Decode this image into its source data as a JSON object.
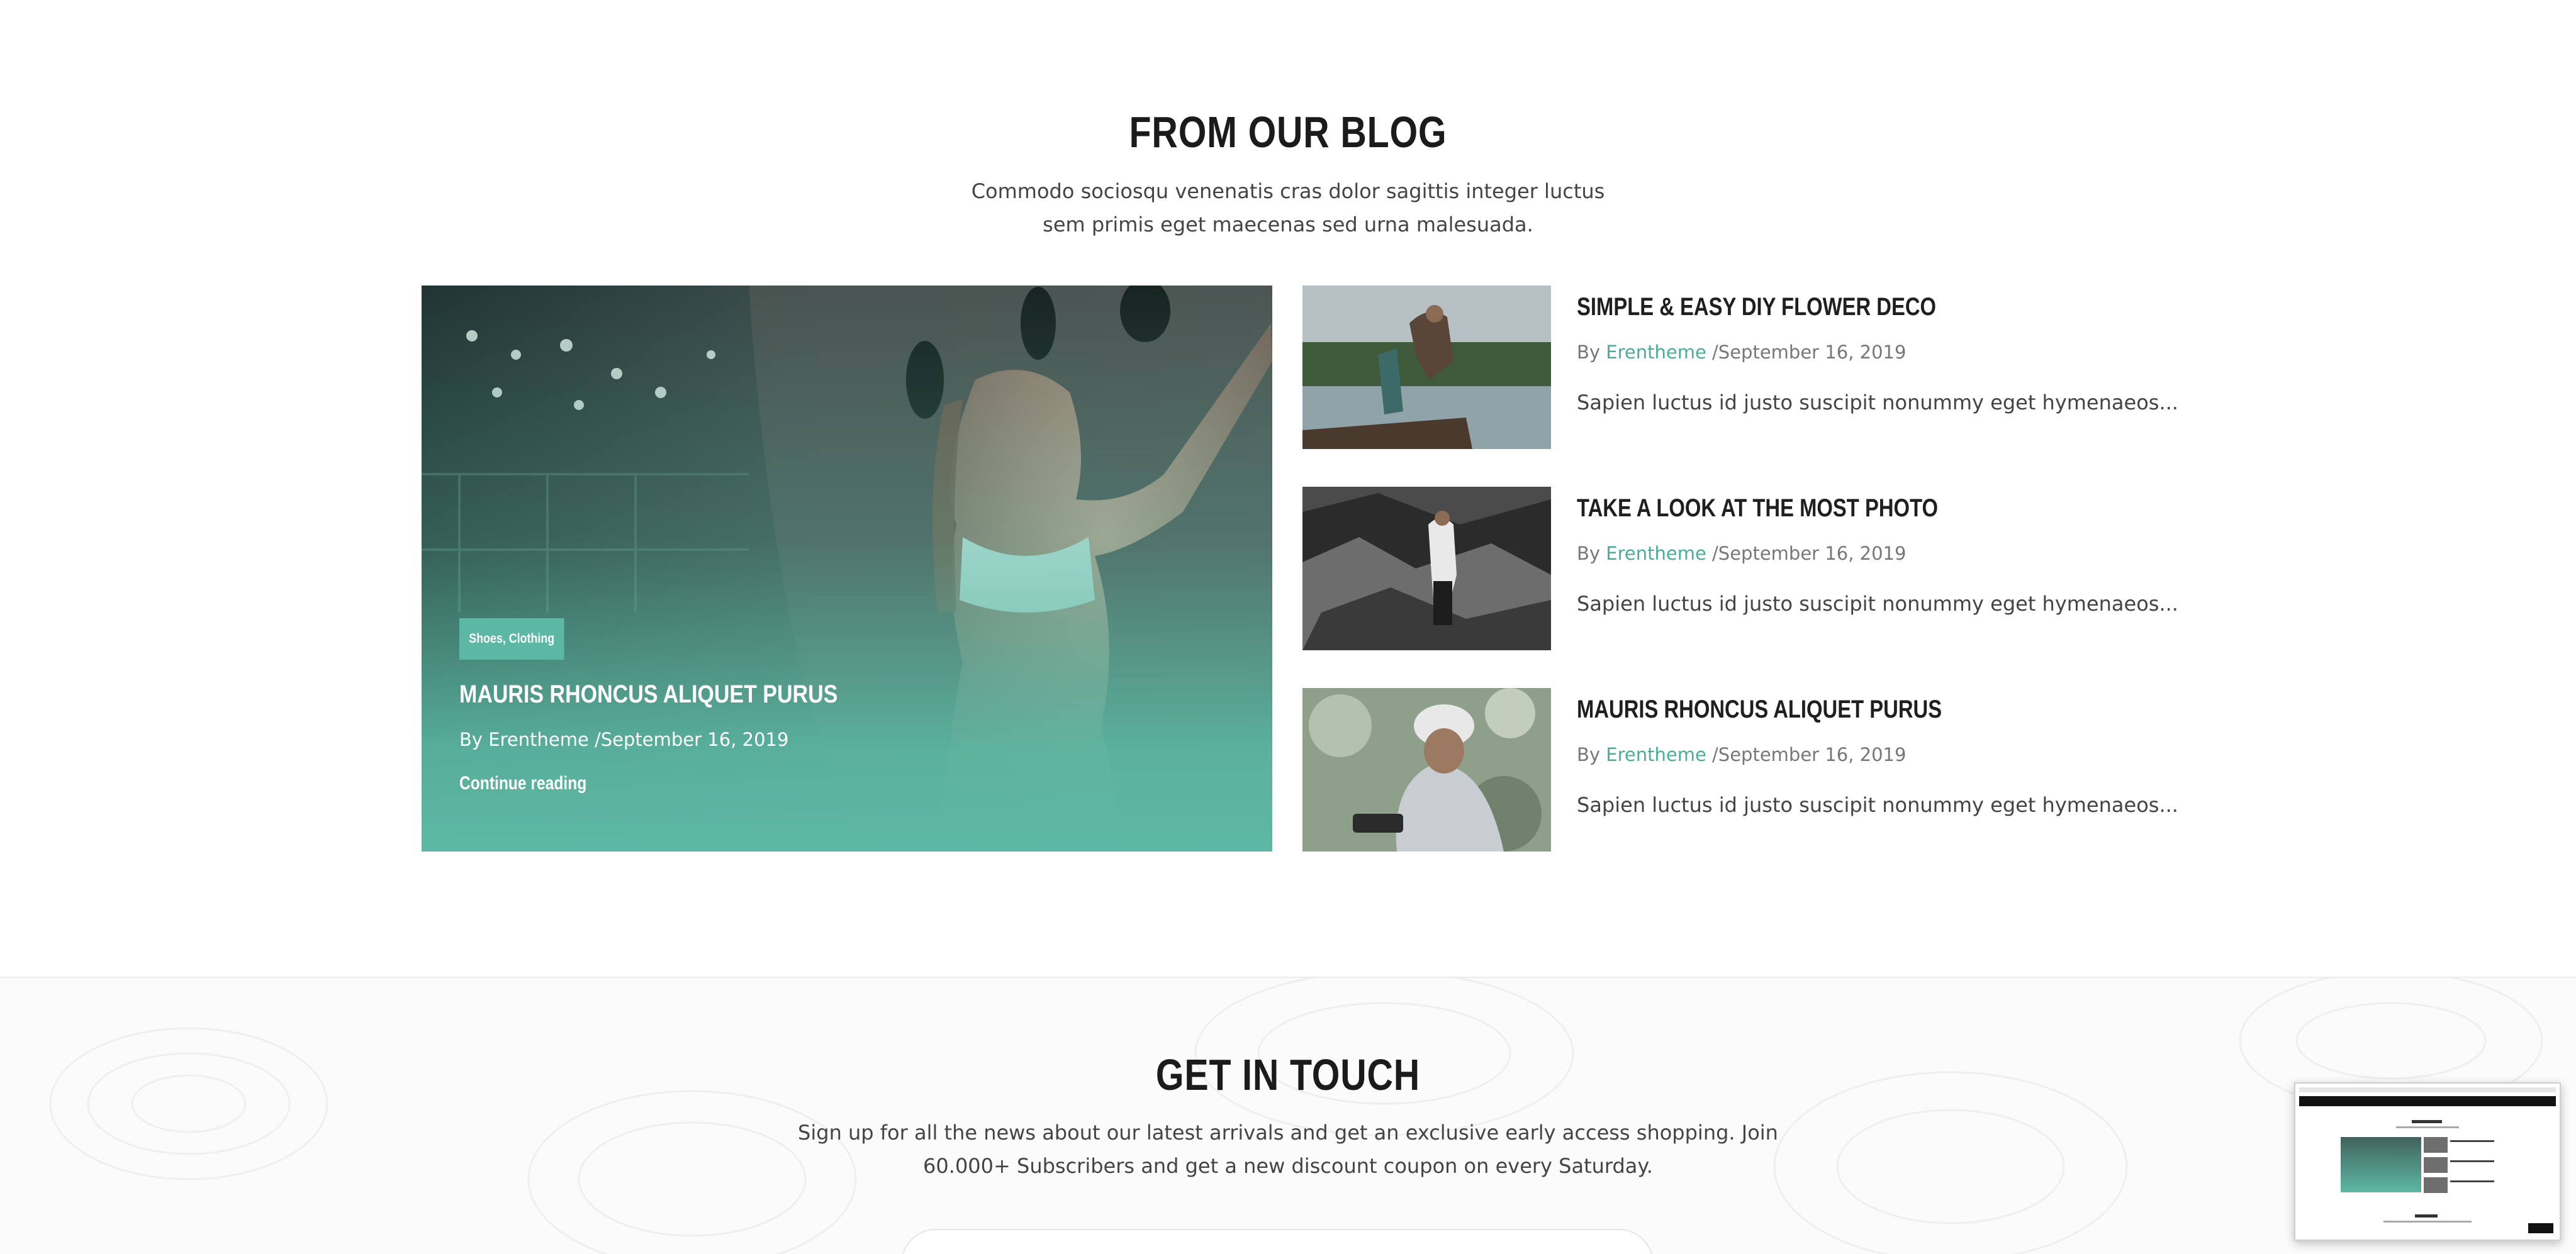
{
  "blog": {
    "title": "FROM OUR BLOG",
    "subtitle": "Commodo sociosqu venenatis cras dolor sagittis integer luctus sem primis eget maecenas sed urna malesuada.",
    "featured": {
      "tag": "Shoes, Clothing",
      "title": "MAURIS RHONCUS ALIQUET PURUS",
      "meta": "By Erentheme /September 16, 2019",
      "link": "Continue reading"
    },
    "posts": [
      {
        "title": "SIMPLE & EASY DIY FLOWER DECO",
        "by": "By ",
        "author": "Erentheme",
        "date": " /September 16, 2019",
        "excerpt": "Sapien luctus id justo suscipit nonummy eget hymenaeos..."
      },
      {
        "title": "TAKE A LOOK AT THE MOST PHOTO",
        "by": "By ",
        "author": "Erentheme",
        "date": " /September 16, 2019",
        "excerpt": "Sapien luctus id justo suscipit nonummy eget hymenaeos..."
      },
      {
        "title": "MAURIS RHONCUS ALIQUET PURUS",
        "by": "By ",
        "author": "Erentheme",
        "date": " /September 16, 2019",
        "excerpt": "Sapien luctus id justo suscipit nonummy eget hymenaeos..."
      }
    ]
  },
  "contact": {
    "title": "GET IN TOUCH",
    "subtitle": "Sign up for all the news about our latest arrivals and get an exclusive early access shopping. Join 60.000+ Subscribers and get a new discount coupon on every Saturday."
  },
  "colors": {
    "accent": "#5cb8a4",
    "author_link": "#4aae98",
    "heading": "#1b1b1b"
  }
}
